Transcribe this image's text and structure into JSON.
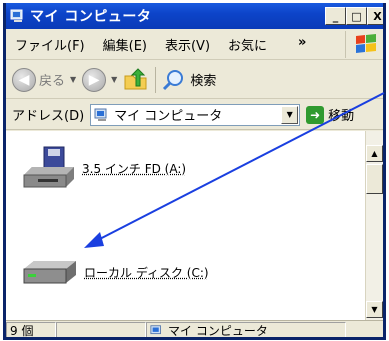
{
  "window": {
    "title": "マイ コンピュータ",
    "minimize_label": "_",
    "maximize_label": "□",
    "close_label": "X"
  },
  "menubar": {
    "items": [
      "ファイル(F)",
      "編集(E)",
      "表示(V)",
      "お気に"
    ],
    "more": "»"
  },
  "toolbar": {
    "back_label": "戻る",
    "search_label": "検索"
  },
  "addressbar": {
    "label": "アドレス(D)",
    "value": "マイ コンピュータ",
    "go_label": "移動"
  },
  "content": {
    "items": [
      {
        "label": "3.5 インチ FD (A:)",
        "icon": "floppy-drive-icon"
      },
      {
        "label": "ローカル ディスク (C:)",
        "icon": "hard-disk-icon"
      }
    ]
  },
  "statusbar": {
    "count": "9 個",
    "location": "マイ コンピュータ"
  },
  "colors": {
    "titlebar": "#0d44c9",
    "annotation_arrow": "#1a3fe0"
  }
}
